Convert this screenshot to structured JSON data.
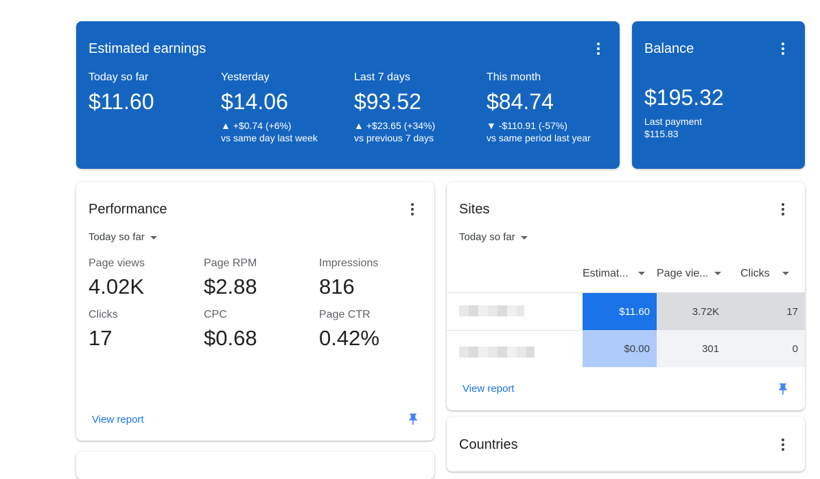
{
  "earnings": {
    "title": "Estimated earnings",
    "stats": [
      {
        "label": "Today so far",
        "value": "$11.60",
        "change": "",
        "compare": ""
      },
      {
        "label": "Yesterday",
        "value": "$14.06",
        "change": "▲ +$0.74 (+6%)",
        "compare": "vs same day last week"
      },
      {
        "label": "Last 7 days",
        "value": "$93.52",
        "change": "▲ +$23.65 (+34%)",
        "compare": "vs previous 7 days"
      },
      {
        "label": "This month",
        "value": "$84.74",
        "change": "▼ -$110.91 (-57%)",
        "compare": "vs same period last year"
      }
    ]
  },
  "balance": {
    "title": "Balance",
    "value": "$195.32",
    "last_payment_label": "Last payment",
    "last_payment_value": "$115.83"
  },
  "performance": {
    "title": "Performance",
    "range": "Today so far",
    "metrics": [
      {
        "label": "Page views",
        "value": "4.02K"
      },
      {
        "label": "Page RPM",
        "value": "$2.88"
      },
      {
        "label": "Impressions",
        "value": "816"
      },
      {
        "label": "Clicks",
        "value": "17"
      },
      {
        "label": "CPC",
        "value": "$0.68"
      },
      {
        "label": "Page CTR",
        "value": "0.42%"
      }
    ],
    "link": "View report"
  },
  "sites": {
    "title": "Sites",
    "range": "Today so far",
    "columns": [
      "Estimat...",
      "Page vie...",
      "Clicks"
    ],
    "rows": [
      {
        "earnings": "$11.60",
        "page_views": "3.72K",
        "clicks": "17"
      },
      {
        "earnings": "$0.00",
        "page_views": "301",
        "clicks": "0"
      }
    ],
    "link": "View report"
  },
  "countries": {
    "title": "Countries"
  },
  "colors": {
    "card_blue": "#1565c0",
    "heat_strong": "#1a73e8",
    "heat_light": "#aecbfa",
    "link": "#1a73e8",
    "pin": "#4285f4"
  }
}
